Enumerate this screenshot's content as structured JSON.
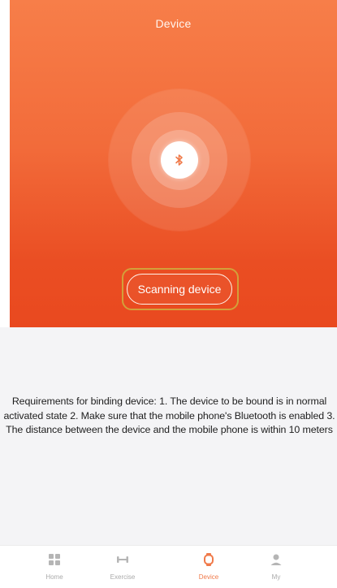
{
  "header": {
    "title": "Device"
  },
  "scan": {
    "button_label": "Scanning device"
  },
  "requirements": {
    "text": "Requirements for binding device: 1. The device to be bound is in normal activated state  2. Make sure that the mobile phone's Bluetooth is enabled  3. The distance between the device and the mobile phone is within 10 meters"
  },
  "tabs": [
    {
      "label": "Home",
      "icon": "grid-icon",
      "active": false
    },
    {
      "label": "Exercise",
      "icon": "dumbbell-icon",
      "active": false
    },
    {
      "label": "Device",
      "icon": "watch-icon",
      "active": true
    },
    {
      "label": "My",
      "icon": "person-icon",
      "active": false
    }
  ],
  "colors": {
    "accent": "#f07a4a",
    "hero_top": "#f77e49",
    "hero_bottom": "#e9491f",
    "highlight": "#d3a03a"
  }
}
